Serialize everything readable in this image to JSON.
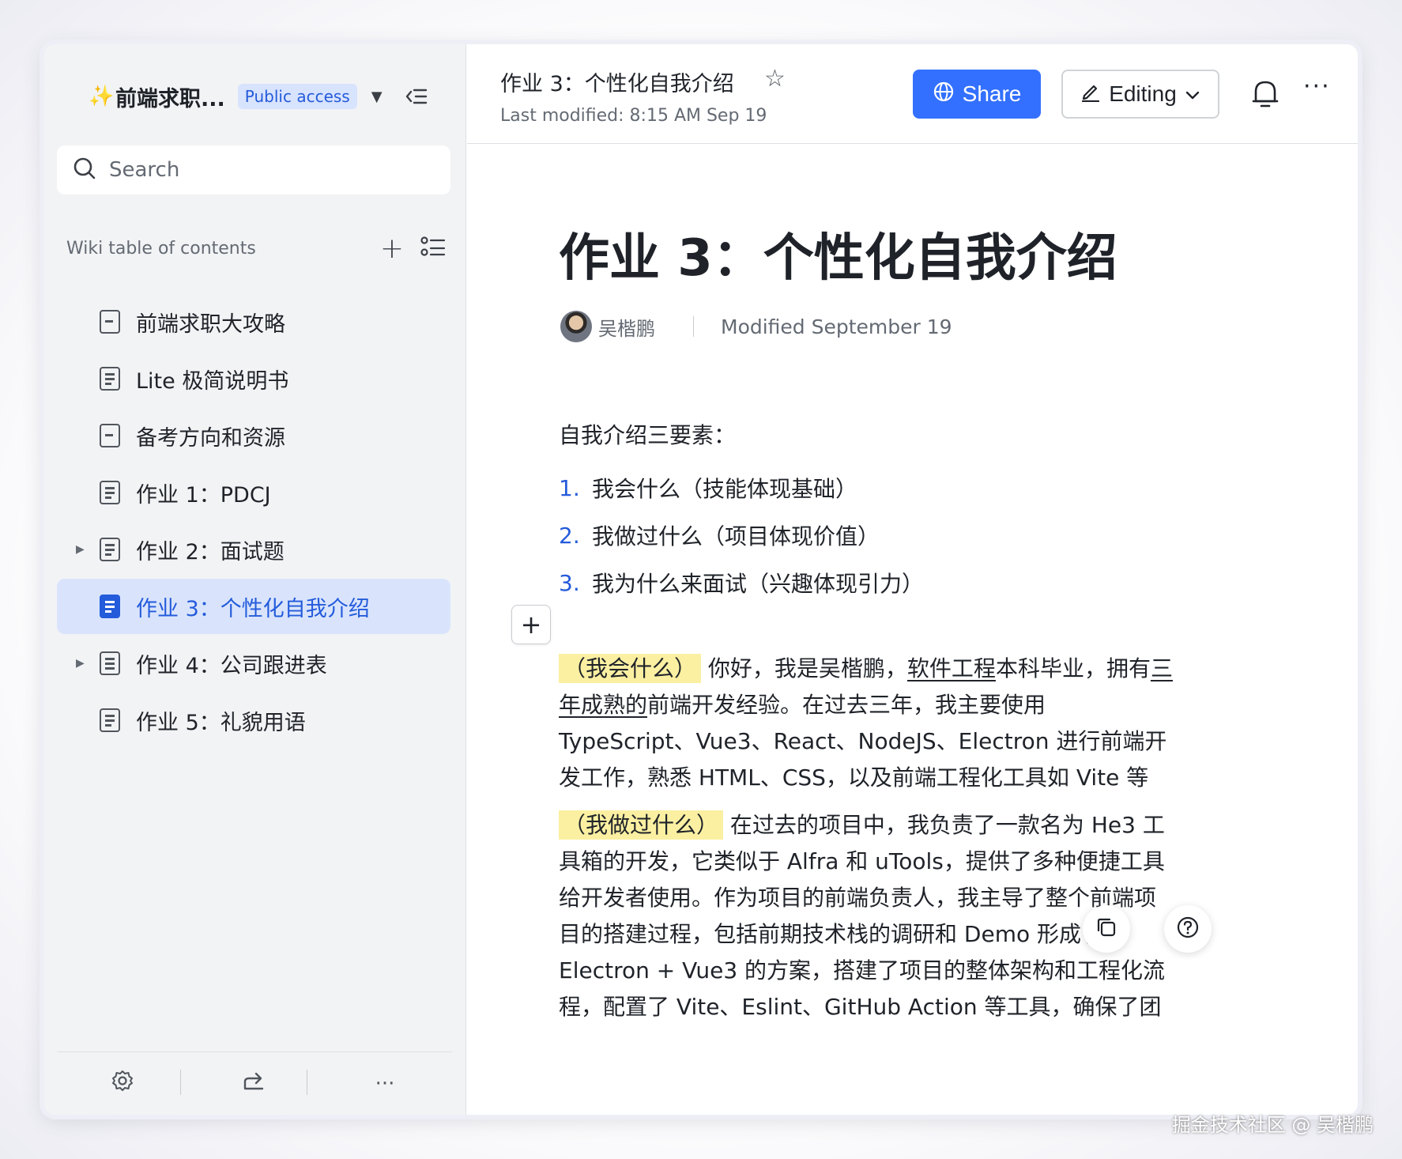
{
  "sidebar": {
    "space_title": "前端求职...",
    "access_badge": "Public access",
    "search_placeholder": "Search",
    "toc_label": "Wiki table of contents",
    "items": [
      {
        "label": "前端求职大攻略"
      },
      {
        "label": "Lite 极简说明书"
      },
      {
        "label": "备考方向和资源"
      },
      {
        "label": "作业 1：PDCJ"
      },
      {
        "label": "作业 2：面试题"
      },
      {
        "label": "作业 3：个性化自我介绍"
      },
      {
        "label": "作业 4：公司跟进表"
      },
      {
        "label": "作业 5：礼貌用语"
      }
    ],
    "footer_more": "···"
  },
  "topbar": {
    "doc_title": "作业 3：个性化自我介绍",
    "last_modified": "Last modified: 8:15 AM Sep 19",
    "share_label": "Share",
    "editing_label": "Editing",
    "more": "···"
  },
  "doc": {
    "title": "作业 3：个性化自我介绍",
    "author": "吴楷鹏",
    "modified": "Modified September 19",
    "intro": "自我介绍三要素：",
    "list": [
      {
        "num": "1.",
        "text": "我会什么（技能体现基础）"
      },
      {
        "num": "2.",
        "text": "我做过什么（项目体现价值）"
      },
      {
        "num": "3.",
        "text": "我为什么来面试（兴趣体现引力）"
      }
    ],
    "p1": {
      "tag": "（我会什么）",
      "t1": " 你好，我是吴楷鹏，",
      "u1": "软件工程",
      "t2": "本科毕业，拥有",
      "u2": "三年成熟的",
      "t3": "前端开发经验。在过去三年，我主要使用 TypeScript、Vue3、React、NodeJS、Electron 进行前端开发工作，熟悉 HTML、CSS，以及前端工程化工具如 Vite 等"
    },
    "p2": {
      "tag": "（我做过什么）",
      "text": " 在过去的项目中，我负责了一款名为 He3 工具箱的开发，它类似于 Alfra 和 uTools，提供了多种便捷工具给开发者使用。作为项目的前端负责人，我主导了整个前端项目的搭建过程，包括前期技术栈的调研和 Demo 形成了 Electron + Vue3 的方案，搭建了项目的整体架构和工程化流程，配置了 Vite、Eslint、GitHub Action 等工具，确保了团"
    }
  },
  "watermark": "掘金技术社区 @ 吴楷鹏",
  "colors": {
    "accent": "#3370ff",
    "active_bg": "#d9e4fc",
    "highlight": "#fbf0a2"
  }
}
